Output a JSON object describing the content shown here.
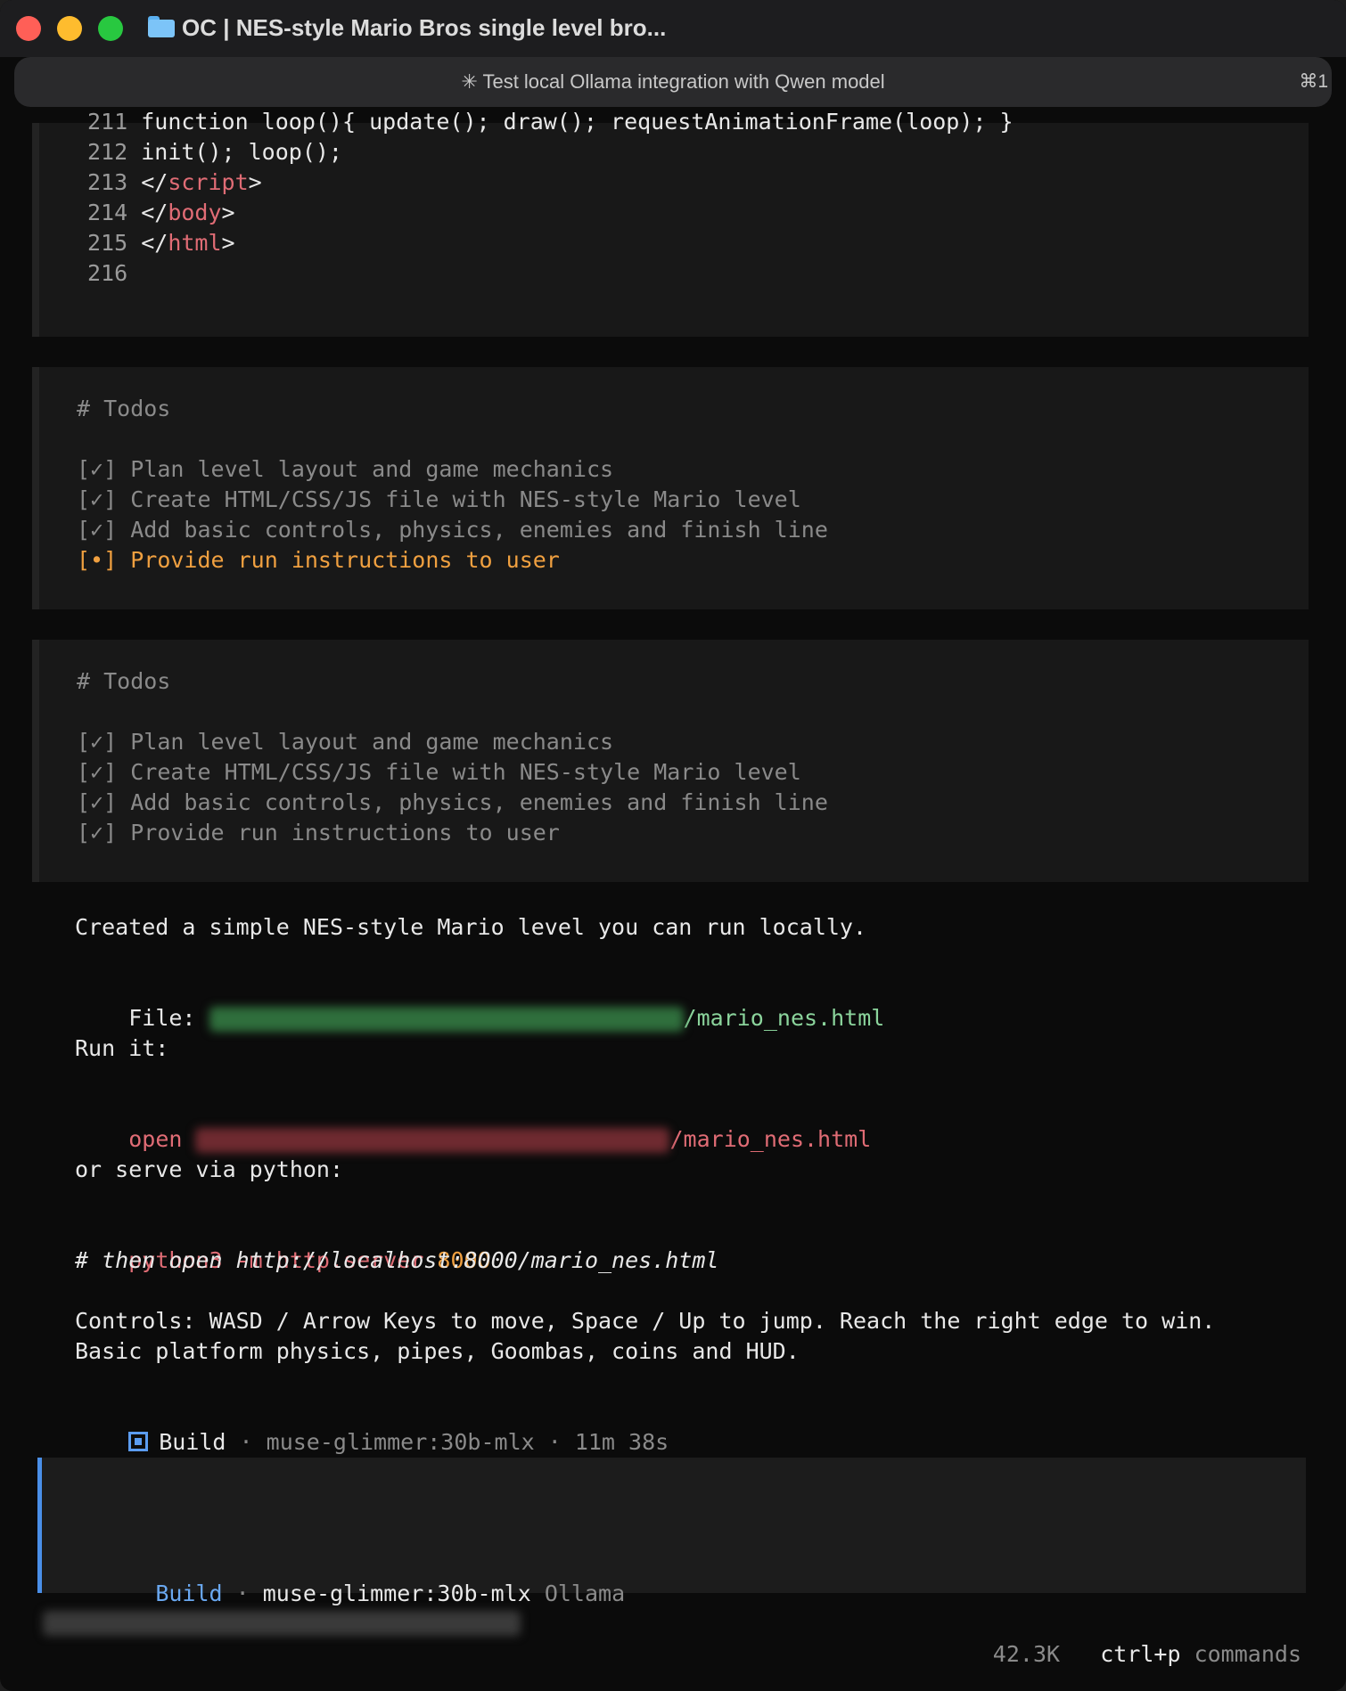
{
  "window": {
    "title": "OC | NES-style Mario Bros single level bro...",
    "tab_title": "✳ Test local Ollama integration with Qwen model",
    "tab_shortcut": "⌘1"
  },
  "code": {
    "lines": [
      {
        "num": "211",
        "parts": [
          {
            "t": "function loop(){ update(); draw(); requestAnimationFrame(loop); }",
            "c": "w"
          }
        ]
      },
      {
        "num": "212",
        "parts": [
          {
            "t": "init(); loop();",
            "c": "w"
          }
        ]
      },
      {
        "num": "213",
        "parts": [
          {
            "t": "</",
            "c": "w"
          },
          {
            "t": "script",
            "c": "tag"
          },
          {
            "t": ">",
            "c": "w"
          }
        ]
      },
      {
        "num": "214",
        "parts": [
          {
            "t": "</",
            "c": "w"
          },
          {
            "t": "body",
            "c": "tag"
          },
          {
            "t": ">",
            "c": "w"
          }
        ]
      },
      {
        "num": "215",
        "parts": [
          {
            "t": "</",
            "c": "w"
          },
          {
            "t": "html",
            "c": "tag"
          },
          {
            "t": ">",
            "c": "w"
          }
        ]
      },
      {
        "num": "216",
        "parts": []
      }
    ]
  },
  "todos1": {
    "heading": "# Todos",
    "items": [
      {
        "mark": "[✓]",
        "text": "Plan level layout and game mechanics",
        "state": "done"
      },
      {
        "mark": "[✓]",
        "text": "Create HTML/CSS/JS file with NES-style Mario level",
        "state": "done"
      },
      {
        "mark": "[✓]",
        "text": "Add basic controls, physics, enemies and finish line",
        "state": "done"
      },
      {
        "mark": "[•]",
        "text": "Provide run instructions to user",
        "state": "active"
      }
    ]
  },
  "todos2": {
    "heading": "# Todos",
    "items": [
      {
        "mark": "[✓]",
        "text": "Plan level layout and game mechanics",
        "state": "done"
      },
      {
        "mark": "[✓]",
        "text": "Create HTML/CSS/JS file with NES-style Mario level",
        "state": "done"
      },
      {
        "mark": "[✓]",
        "text": "Add basic controls, physics, enemies and finish line",
        "state": "done"
      },
      {
        "mark": "[✓]",
        "text": "Provide run instructions to user",
        "state": "done"
      }
    ]
  },
  "message": {
    "created": "Created a simple NES-style Mario level you can run locally.",
    "file_label": "File: ",
    "file_suffix": "/mario_nes.html",
    "run_label": "Run it:",
    "open_cmd": "open ",
    "open_suffix": "/mario_nes.html",
    "serve_label": "or serve via python:",
    "py_cmd": "python3 -m http.server ",
    "py_port": "8000",
    "py_comment": "# then open http://localhost:8000/mario_nes.html",
    "controls": "Controls: WASD / Arrow Keys to move, Space / Up to jump. Reach the right edge to win.",
    "features": "Basic platform physics, pipes, Goombas, coins and HUD."
  },
  "build_status": {
    "label": "Build",
    "sep1": " · ",
    "model": "muse-glimmer:30b-mlx",
    "sep2": " · ",
    "duration": "11m 38s"
  },
  "input": {
    "mode": "Build",
    "sep": " · ",
    "model": "muse-glimmer:30b-mlx",
    "provider": " Ollama"
  },
  "footer": {
    "tokens": "42.3K",
    "key": "ctrl+p",
    "key_label": " commands"
  },
  "colors": {
    "accent_blue": "#4a8fe8",
    "active_orange": "#f0a040",
    "path_green": "#8bd49c",
    "cmd_red": "#e06c75"
  }
}
